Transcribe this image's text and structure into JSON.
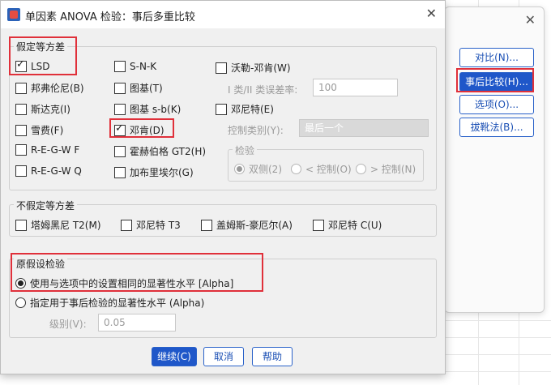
{
  "dialog": {
    "title": "单因素 ANOVA 检验：事后多重比较",
    "close": "✕"
  },
  "equal_var": {
    "title": "假定等方差",
    "items": [
      {
        "label": "LSD",
        "checked": true
      },
      {
        "label": "邦弗伦尼(B)",
        "checked": false
      },
      {
        "label": "斯达克(I)",
        "checked": false
      },
      {
        "label": "雪费(F)",
        "checked": false
      },
      {
        "label": "R-E-G-W F",
        "checked": false
      },
      {
        "label": "R-E-G-W Q",
        "checked": false
      },
      {
        "label": "S-N-K",
        "checked": false
      },
      {
        "label": "图基(T)",
        "checked": false
      },
      {
        "label": "图基 s-b(K)",
        "checked": false
      },
      {
        "label": "邓肯(D)",
        "checked": true
      },
      {
        "label": "霍赫伯格 GT2(H)",
        "checked": false
      },
      {
        "label": "加布里埃尔(G)",
        "checked": false
      },
      {
        "label": "沃勒-邓肯(W)",
        "checked": false
      },
      {
        "label": "邓尼特(E)",
        "checked": false
      }
    ],
    "error_ratio_label": "I 类/II 类误差率:",
    "error_ratio_value": "100",
    "control_label": "控制类别(Y):",
    "control_value": "最后一个",
    "test_title": "检验",
    "test_options": [
      "双侧(2)",
      "< 控制(O)",
      "> 控制(N)"
    ]
  },
  "unequal_var": {
    "title": "不假定等方差",
    "items": [
      "塔姆黑尼 T2(M)",
      "邓尼特 T3",
      "盖姆斯-豪厄尔(A)",
      "邓尼特 C(U)"
    ]
  },
  "null_hyp": {
    "title": "原假设检验",
    "option1": "使用与选项中的设置相同的显著性水平 [Alpha]",
    "option2": "指定用于事后检验的显著性水平 (Alpha)",
    "level_label": "级别(V):",
    "level_value": "0.05"
  },
  "buttons": {
    "continue": "继续(C)",
    "cancel": "取消",
    "help": "帮助"
  },
  "bg_dialog": {
    "close": "✕",
    "buttons": [
      "对比(N)...",
      "事后比较(H)...",
      "选项(O)...",
      "拔靴法(B)..."
    ]
  }
}
